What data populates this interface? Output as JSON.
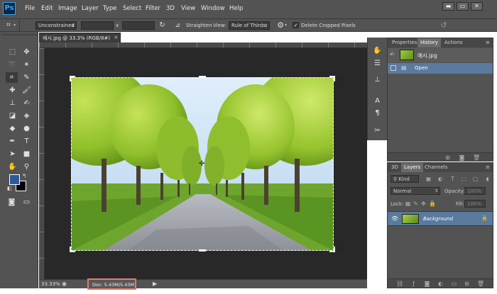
{
  "app": {
    "logo": "Ps"
  },
  "menu": {
    "items": [
      "File",
      "Edit",
      "Image",
      "Layer",
      "Type",
      "Select",
      "Filter",
      "3D",
      "View",
      "Window",
      "Help"
    ]
  },
  "window_controls": {
    "minimize": "▬",
    "restore": "▭",
    "close": "✕"
  },
  "options_bar": {
    "ratio_value": "Unconstrained",
    "times": "x",
    "straighten_label": "Straighten",
    "view_label": "View:",
    "view_value": "Rule of Thirds",
    "delete_cropped_label": "Delete Cropped Pixels",
    "delete_cropped_checked": true
  },
  "document": {
    "tab_title": "예시.jpg @ 33.3% (RGB/8#)",
    "zoom": "33.33%",
    "doc_size": "Doc: 5.43M/5.43M"
  },
  "history_panel": {
    "tabs": [
      "Properties",
      "History",
      "Actions"
    ],
    "active_tab": "History",
    "snapshot_label": "예시.jpg",
    "steps": [
      "Open"
    ]
  },
  "layers_panel": {
    "tabs": [
      "3D",
      "Layers",
      "Channels"
    ],
    "active_tab": "Layers",
    "filter_kind": "Kind",
    "blend_mode": "Normal",
    "opacity_label": "Opacity:",
    "opacity_value": "100%",
    "lock_label": "Lock:",
    "fill_label": "Fill:",
    "fill_value": "100%",
    "layers": [
      {
        "name": "Background",
        "visible": true,
        "locked": true
      }
    ]
  },
  "colors": {
    "foreground": "#2a5a9c",
    "background": "#000000",
    "ui_dark": "#535353",
    "canvas_bg": "#282828",
    "accent": "#31a8ff"
  }
}
